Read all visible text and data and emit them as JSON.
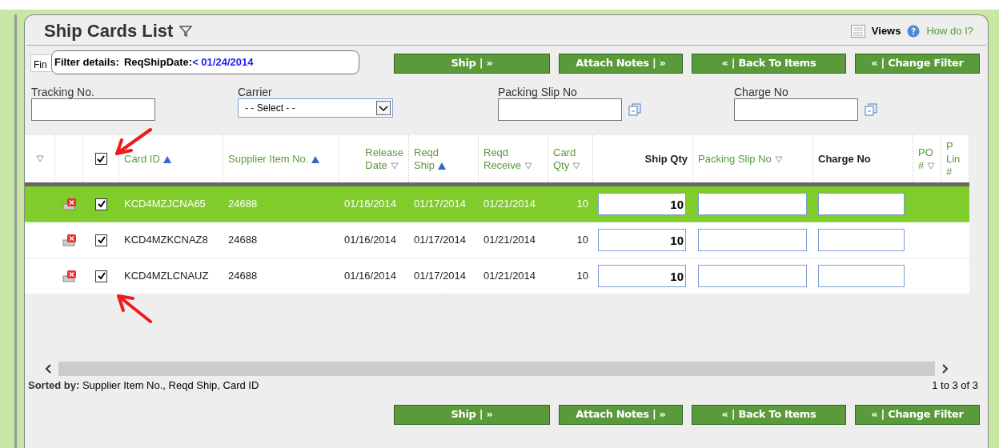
{
  "header": {
    "title": "Ship Cards List",
    "views": "Views",
    "help": "How do I?"
  },
  "filter": {
    "hidden_button": "Fin",
    "label": "Filter details:",
    "field": "ReqShipDate:",
    "value": "< 01/24/2014"
  },
  "top_actions": [
    "Ship | »",
    "Attach Notes | »",
    "« | Back To Items",
    "« | Change Filter"
  ],
  "bottom_actions": [
    "Ship | »",
    "Attach Notes | »",
    "« | Back To Items",
    "« | Change Filter"
  ],
  "fields": [
    {
      "kind": "text",
      "label": "Tracking No."
    },
    {
      "kind": "select",
      "label": "Carrier",
      "value": "- - Select - -"
    },
    {
      "kind": "copy",
      "label": "Packing Slip No"
    },
    {
      "kind": "copy",
      "label": "Charge No"
    }
  ],
  "table": {
    "select_all_checked": true,
    "columns": [
      {
        "lines": [
          "Card ID"
        ],
        "ascending": true,
        "sortable": true
      },
      {
        "lines": [
          "Supplier Item No."
        ],
        "ascending": true,
        "sortable": true
      },
      {
        "lines": [
          "Release",
          "Date"
        ],
        "ascending": false,
        "sortable": true
      },
      {
        "lines": [
          "Reqd",
          "Ship"
        ],
        "ascending": true,
        "sortable": true
      },
      {
        "lines": [
          "Reqd",
          "Receive"
        ],
        "ascending": false,
        "sortable": true
      },
      {
        "lines": [
          "Card",
          "Qty"
        ],
        "ascending": false,
        "sortable": true
      },
      {
        "lines": [
          "Ship Qty"
        ],
        "sortable": false
      },
      {
        "lines": [
          "Packing Slip No"
        ],
        "ascending": false,
        "sortable": true
      },
      {
        "lines": [
          "Charge No"
        ],
        "sortable": false
      },
      {
        "lines": [
          "PO",
          "#"
        ],
        "ascending": false,
        "sortable": true
      },
      {
        "lines": [
          "P",
          "Lin",
          "#"
        ],
        "sortable": true
      }
    ],
    "rows": [
      {
        "selected": true,
        "checked": true,
        "card_id": "KCD4MZJCNA65",
        "supplier_item": "24688",
        "release": "01/16/2014",
        "reqd_ship": "01/17/2014",
        "reqd_receive": "01/21/2014",
        "card_qty": "10",
        "ship_qty": "10"
      },
      {
        "selected": false,
        "checked": true,
        "card_id": "KCD4MZKCNAZ8",
        "supplier_item": "24688",
        "release": "01/16/2014",
        "reqd_ship": "01/17/2014",
        "reqd_receive": "01/21/2014",
        "card_qty": "10",
        "ship_qty": "10"
      },
      {
        "selected": false,
        "checked": true,
        "card_id": "KCD4MZLCNAUZ",
        "supplier_item": "24688",
        "release": "01/16/2014",
        "reqd_ship": "01/17/2014",
        "reqd_receive": "01/21/2014",
        "card_qty": "10",
        "ship_qty": "10"
      }
    ]
  },
  "footer": {
    "sorted_label": "Sorted by:",
    "sorted_value": "Supplier Item No., Reqd Ship, Card ID",
    "pager": "1 to 3 of 3"
  }
}
